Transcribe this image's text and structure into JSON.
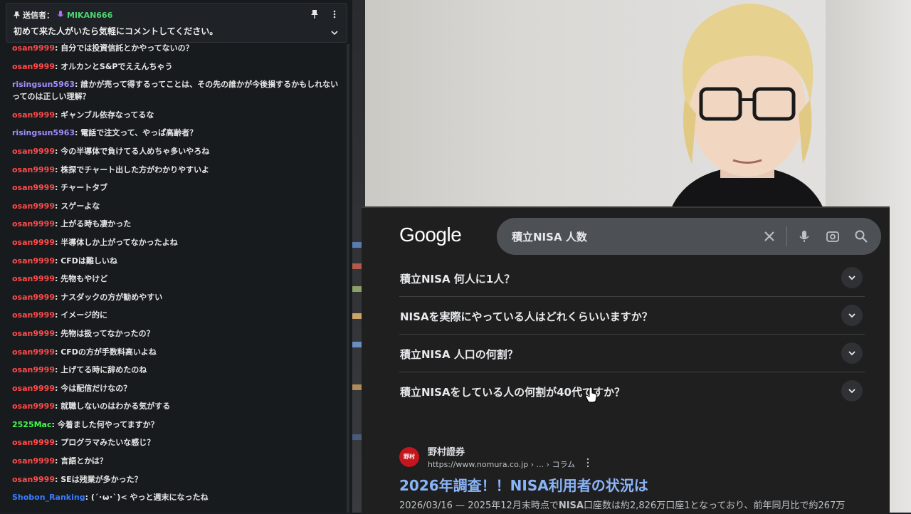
{
  "chat": {
    "pinned": {
      "sender_label": "送信者：",
      "sender_name": "MIKAN666",
      "text": "初めて来た人がいたら気軽にコメントしてください。"
    },
    "messages": [
      {
        "user": "osan9999",
        "color": "#ff4a4a",
        "text": "自分では投資信託とかやってないの？"
      },
      {
        "user": "osan9999",
        "color": "#ff4a4a",
        "text": "オルカンとS&Pでええんちゃう"
      },
      {
        "user": "risingsun5963",
        "color": "#9f8fff",
        "text": "誰かが売って得するってことは、その先の誰かが今後損するかもしれない",
        "text2": "ってのは正しい理解？"
      },
      {
        "user": "osan9999",
        "color": "#ff4a4a",
        "text": "ギャンブル依存なってるな"
      },
      {
        "user": "risingsun5963",
        "color": "#9f8fff",
        "text": "電話で注文って、やっぱ高齢者？"
      },
      {
        "user": "osan9999",
        "color": "#ff4a4a",
        "text": "今の半導体で負けてる人めちゃ多いやろね"
      },
      {
        "user": "osan9999",
        "color": "#ff4a4a",
        "text": "株探でチャート出した方がわかりやすいよ"
      },
      {
        "user": "osan9999",
        "color": "#ff4a4a",
        "text": "チャートタブ"
      },
      {
        "user": "osan9999",
        "color": "#ff4a4a",
        "text": "スゲーよな"
      },
      {
        "user": "osan9999",
        "color": "#ff4a4a",
        "text": "上がる時も凄かった"
      },
      {
        "user": "osan9999",
        "color": "#ff4a4a",
        "text": "半導体しか上がってなかったよね"
      },
      {
        "user": "osan9999",
        "color": "#ff4a4a",
        "text": "CFDは難しいね"
      },
      {
        "user": "osan9999",
        "color": "#ff4a4a",
        "text": "先物もやけど"
      },
      {
        "user": "osan9999",
        "color": "#ff4a4a",
        "text": "ナスダックの方が勧めやすい"
      },
      {
        "user": "osan9999",
        "color": "#ff4a4a",
        "text": "イメージ的に"
      },
      {
        "user": "osan9999",
        "color": "#ff4a4a",
        "text": "先物は扱ってなかったの？"
      },
      {
        "user": "osan9999",
        "color": "#ff4a4a",
        "text": "CFDの方が手数料高いよね"
      },
      {
        "user": "osan9999",
        "color": "#ff4a4a",
        "text": "上げてる時に辞めたのね"
      },
      {
        "user": "osan9999",
        "color": "#ff4a4a",
        "text": "今は配信だけなの？"
      },
      {
        "user": "osan9999",
        "color": "#ff4a4a",
        "text": "就職しないのはわかる気がする"
      },
      {
        "user": "2525Mac",
        "color": "#3dff4a",
        "text": "今着ました何やってますか？"
      },
      {
        "user": "osan9999",
        "color": "#ff4a4a",
        "text": "プログラマみたいな感じ？"
      },
      {
        "user": "osan9999",
        "color": "#ff4a4a",
        "text": "言語とかは？"
      },
      {
        "user": "osan9999",
        "color": "#ff4a4a",
        "text": "SEは残業が多かった？"
      },
      {
        "user": "Shobon_Ranking",
        "color": "#3a7bff",
        "text": "(´･ω･`)< やっと週末になったね"
      }
    ]
  },
  "google": {
    "logo": "Google",
    "search_query": "積立NISA 人数",
    "questions": [
      "積立NISA 何人に1人？",
      "NISAを実際にやっている人はどれくらいいますか？",
      "積立NISA 人口の何割？",
      "積立NISAをしている人の何割が40代ですか？"
    ],
    "result": {
      "favicon_text": "野村",
      "site_name": "野村證券",
      "url": "https://www.nomura.co.jp › ... › コラム",
      "title": "2026年調査！！NISA利用者の状況は",
      "snippet_date": "2026/03/16 — ",
      "snippet_a": "2025年12月末時点で",
      "snippet_b": "NISA",
      "snippet_c": "口座数は約2,826万口座1となっており、前年同月比で約267万"
    }
  },
  "colors": {
    "accent_link": "#8ab4f8",
    "chat_bg": "#181b1e",
    "google_bg": "#1f1f1f"
  }
}
